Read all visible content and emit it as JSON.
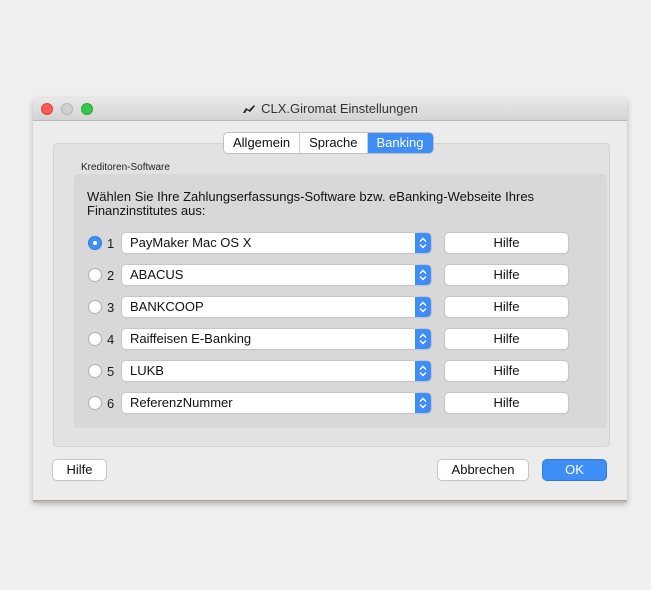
{
  "window": {
    "title": "CLX.Giromat Einstellungen"
  },
  "tabs": [
    {
      "label": "Allgemein",
      "active": false
    },
    {
      "label": "Sprache",
      "active": false
    },
    {
      "label": "Banking",
      "active": true
    }
  ],
  "group": {
    "label": "Kreditoren-Software",
    "description": "Wählen Sie Ihre Zahlungserfassungs-Software bzw. eBanking-Webseite Ihres Finanzinstitutes aus:"
  },
  "options": [
    {
      "number": "1",
      "selected": true,
      "value": "PayMaker Mac OS X",
      "help_label": "Hilfe"
    },
    {
      "number": "2",
      "selected": false,
      "value": "ABACUS",
      "help_label": "Hilfe"
    },
    {
      "number": "3",
      "selected": false,
      "value": "BANKCOOP",
      "help_label": "Hilfe"
    },
    {
      "number": "4",
      "selected": false,
      "value": "Raiffeisen E-Banking",
      "help_label": "Hilfe"
    },
    {
      "number": "5",
      "selected": false,
      "value": "LUKB",
      "help_label": "Hilfe"
    },
    {
      "number": "6",
      "selected": false,
      "value": "ReferenzNummer",
      "help_label": "Hilfe"
    }
  ],
  "footer": {
    "help_label": "Hilfe",
    "cancel_label": "Abbrechen",
    "ok_label": "OK"
  },
  "colors": {
    "accent": "#3f8ef8",
    "close": "#fc5b57",
    "maximize": "#34c84a"
  }
}
